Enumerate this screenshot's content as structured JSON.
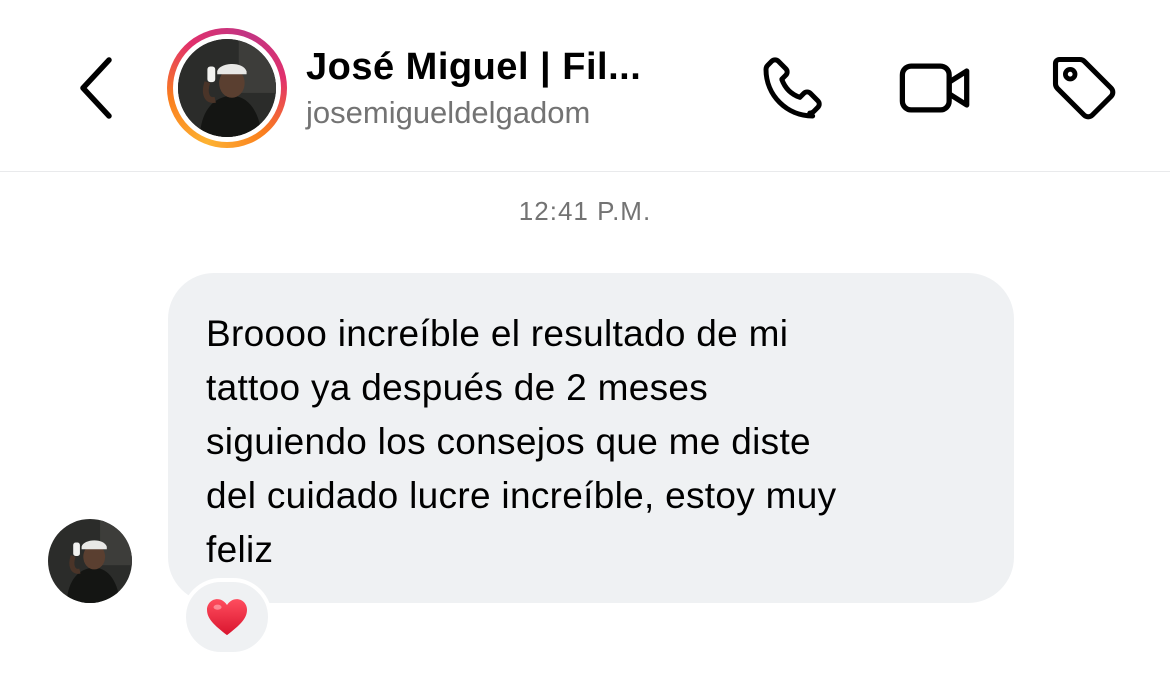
{
  "header": {
    "contact_name": "José Miguel | Fil...",
    "username": "josemigueldelgadom",
    "icons": [
      "back-chevron-icon",
      "phone-icon",
      "video-camera-icon",
      "tag-icon"
    ]
  },
  "thread": {
    "timestamp": "12:41 P.M.",
    "messages": [
      {
        "sender": "contact",
        "text": "Broooo increíble el resultado de mi\ntattoo ya después de 2 meses\nsiguiendo los consejos que me diste\ndel cuidado lucre increíble, estoy muy\nfeliz",
        "reaction": "❤️"
      }
    ]
  },
  "colors": {
    "bubble_bg": "#eff1f3",
    "secondary_text": "#737373",
    "reaction_heart": "#e0245e",
    "story_ring": [
      "#fdb232",
      "#fa7e1e",
      "#e1306c",
      "#c13584"
    ]
  }
}
